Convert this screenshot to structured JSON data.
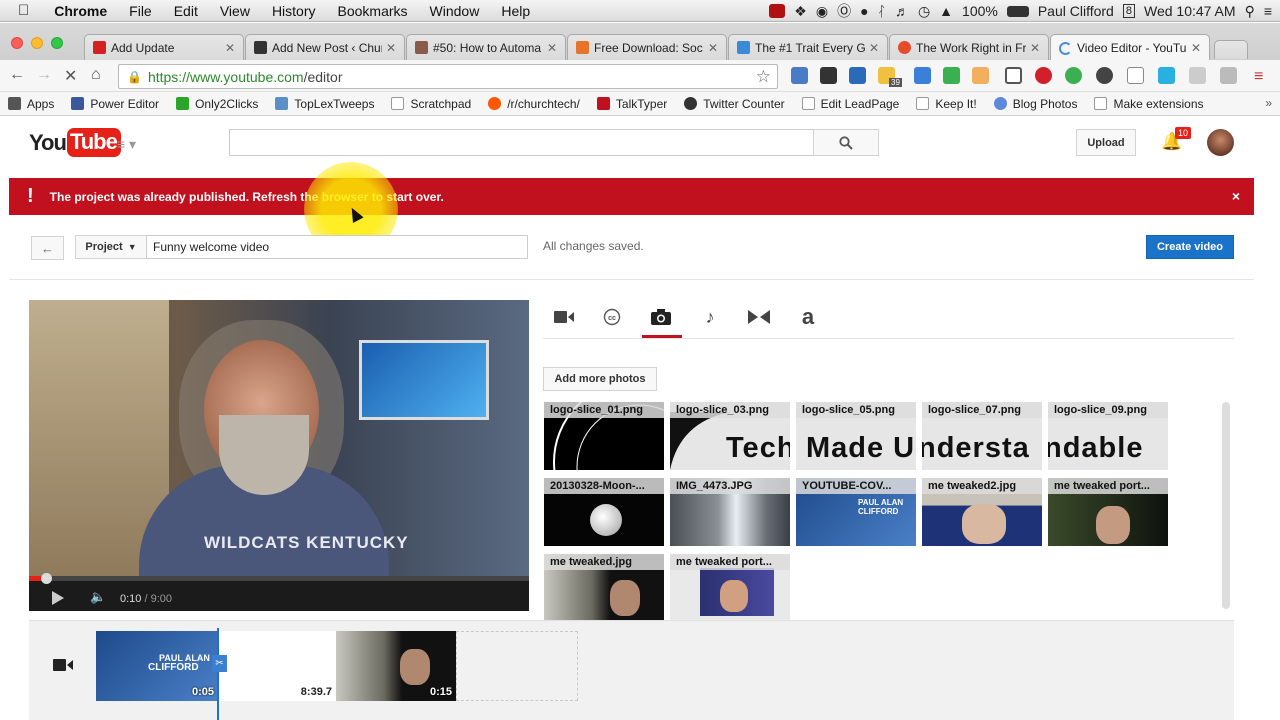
{
  "menubar": {
    "app": "Chrome",
    "items": [
      "File",
      "Edit",
      "View",
      "History",
      "Bookmarks",
      "Window",
      "Help"
    ],
    "battery": "100%",
    "user": "Paul Clifford",
    "datetime": "Wed 10:47 AM",
    "calendar_day": "8"
  },
  "tabs": [
    {
      "title": "Add Update",
      "color": "#d62020"
    },
    {
      "title": "Add New Post ‹ Chur",
      "color": "#333333"
    },
    {
      "title": "#50: How to Automa",
      "color": "#8a5a4a"
    },
    {
      "title": "Free Download: Soc",
      "color": "#e8742a"
    },
    {
      "title": "The #1 Trait Every G",
      "color": "#3a8ad8"
    },
    {
      "title": "The Work Right in Fr",
      "color": "#e54c2a"
    },
    {
      "title": "Video Editor - YouTu",
      "color": "#4a90d9",
      "active": true
    }
  ],
  "omnibox": {
    "scheme": "https://",
    "host": "www.youtube.com",
    "path": "/editor"
  },
  "extension_badge": "39",
  "bookmarks": [
    {
      "label": "Apps",
      "color": "#555555"
    },
    {
      "label": "Power Editor",
      "color": "#3b5998"
    },
    {
      "label": "Only2Clicks",
      "color": "#2aa52a"
    },
    {
      "label": "TopLexTweeps",
      "color": "#5b8fc7"
    },
    {
      "label": "Scratchpad",
      "color": "#dddddd"
    },
    {
      "label": "/r/churchtech/",
      "color": "#ff5700"
    },
    {
      "label": "TalkTyper",
      "color": "#c1111f"
    },
    {
      "label": "Twitter Counter",
      "color": "#333333"
    },
    {
      "label": "Edit LeadPage",
      "color": "#dddddd"
    },
    {
      "label": "Keep It!",
      "color": "#dddddd"
    },
    {
      "label": "Blog Photos",
      "color": "#5a8ad8"
    },
    {
      "label": "Make extensions",
      "color": "#dddddd"
    }
  ],
  "youtube": {
    "logo_you": "You",
    "logo_tube": "Tube",
    "upload": "Upload",
    "notification_count": "10"
  },
  "alert": {
    "message": "The project was already published. Refresh the browser to start over.",
    "close": "×"
  },
  "project": {
    "label": "Project",
    "name": "Funny welcome video",
    "status": "All changes saved.",
    "create": "Create video"
  },
  "player": {
    "current": "0:10",
    "duration": "9:00",
    "video_text": "WILDCATS KENTUCKY"
  },
  "tools": [
    "video-tab-icon",
    "cc-tab-icon",
    "photo-tab-icon",
    "music-tab-icon",
    "transitions-tab-icon",
    "titles-tab-icon"
  ],
  "add_photos": "Add more photos",
  "photos": [
    {
      "name": "logo-slice_01.png",
      "text": "",
      "bg": "#000000"
    },
    {
      "name": "logo-slice_03.png",
      "text": "Tech",
      "bg": "#e6e6e6"
    },
    {
      "name": "logo-slice_05.png",
      "text": "Made U",
      "bg": "#e6e6e6"
    },
    {
      "name": "logo-slice_07.png",
      "text": "nderstа",
      "bg": "#e6e6e6"
    },
    {
      "name": "logo-slice_09.png",
      "text": "ndable",
      "bg": "#e6e6e6"
    },
    {
      "name": "20130328-Moon-...",
      "text": "",
      "bg": "#050505"
    },
    {
      "name": "IMG_4473.JPG",
      "text": "",
      "bg": "#6a7078"
    },
    {
      "name": "YOUTUBE-COV...",
      "text": "",
      "bg": "#2a5a9a"
    },
    {
      "name": "me tweaked2.jpg",
      "text": "",
      "bg": "#243a8a"
    },
    {
      "name": "me tweaked port...",
      "text": "",
      "bg": "#1a2a1a"
    },
    {
      "name": "me tweaked.jpg",
      "text": "",
      "bg": "#1a2a1a"
    },
    {
      "name": "me tweaked port...",
      "text": "",
      "bg": "#3a3a7a"
    }
  ],
  "timeline": {
    "clips": [
      {
        "label": "0:05"
      },
      {
        "label": "8:39.7"
      },
      {
        "label": "0:15"
      }
    ],
    "cover_text": [
      "PAUL ALAN",
      "CLIFFORD"
    ]
  }
}
